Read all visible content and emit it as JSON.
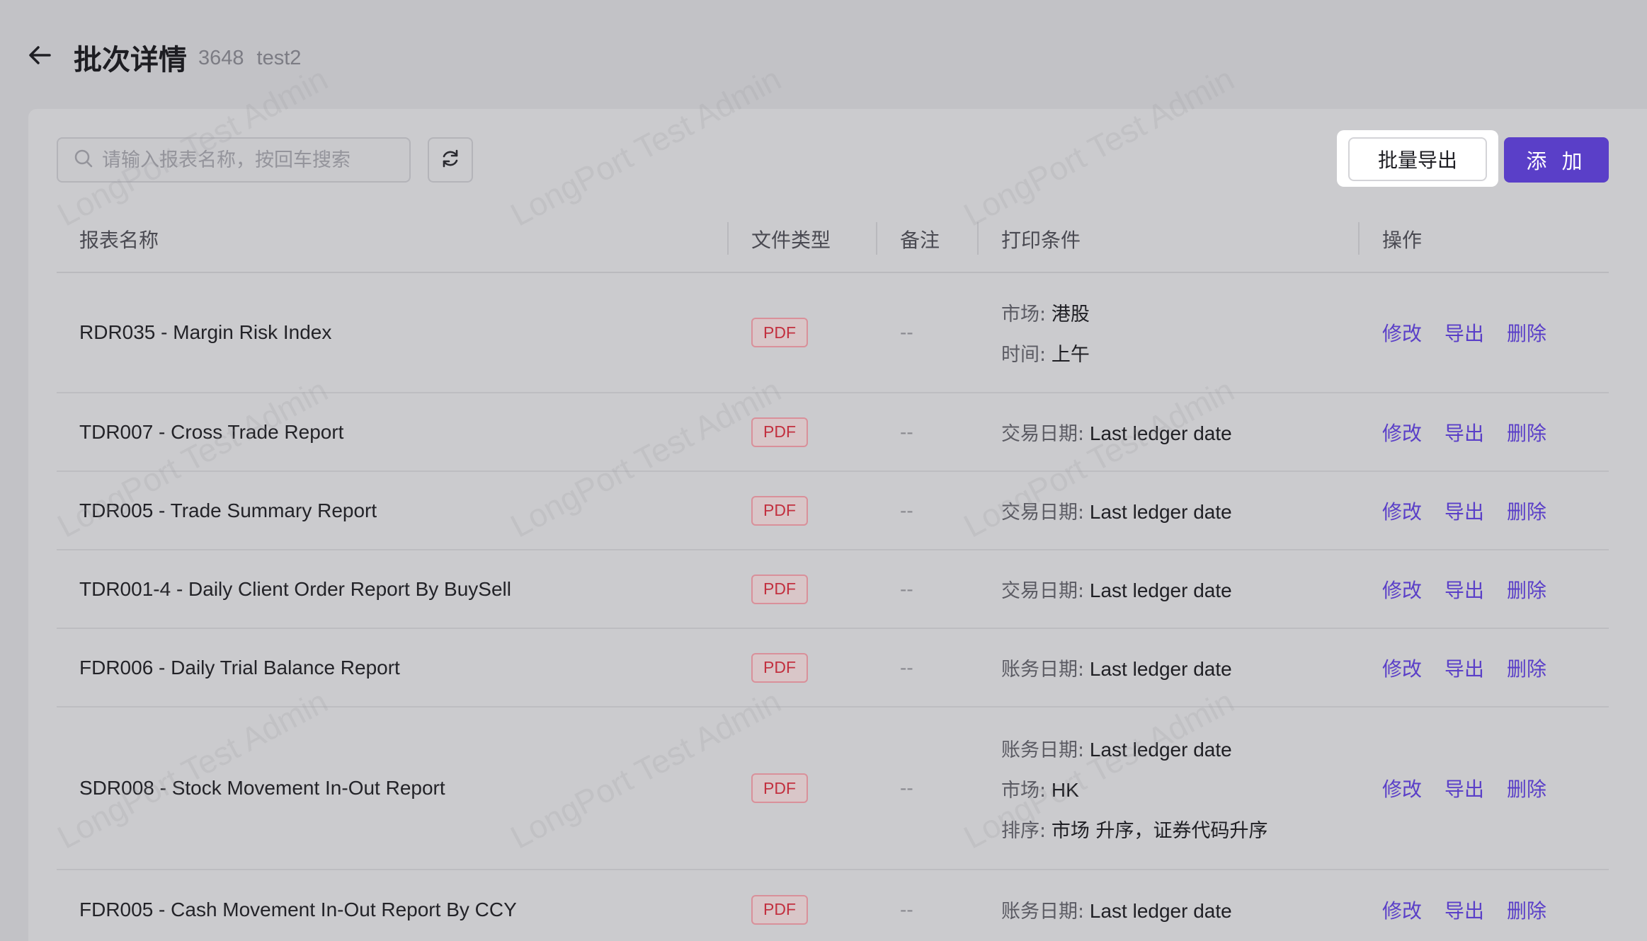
{
  "header": {
    "title": "批次详情",
    "batch_id": "3648",
    "batch_name": "test2"
  },
  "toolbar": {
    "search_placeholder": "请输入报表名称，按回车搜索",
    "batch_export_label": "批量导出",
    "add_label": "添 加"
  },
  "table": {
    "columns": [
      "报表名称",
      "文件类型",
      "备注",
      "打印条件",
      "操作"
    ],
    "rows": [
      {
        "name": "RDR035 - Margin Risk Index",
        "type": "PDF",
        "note": "--",
        "conditions": [
          {
            "key": "市场:",
            "value": "港股"
          },
          {
            "key": "时间:",
            "value": "上午"
          }
        ]
      },
      {
        "name": "TDR007 - Cross Trade Report",
        "type": "PDF",
        "note": "--",
        "conditions": [
          {
            "key": "交易日期:",
            "value": "Last ledger date"
          }
        ]
      },
      {
        "name": "TDR005 - Trade Summary Report",
        "type": "PDF",
        "note": "--",
        "conditions": [
          {
            "key": "交易日期:",
            "value": "Last ledger date"
          }
        ]
      },
      {
        "name": "TDR001-4 - Daily Client Order Report By BuySell",
        "type": "PDF",
        "note": "--",
        "conditions": [
          {
            "key": "交易日期:",
            "value": "Last ledger date"
          }
        ]
      },
      {
        "name": "FDR006 - Daily Trial Balance Report",
        "type": "PDF",
        "note": "--",
        "conditions": [
          {
            "key": "账务日期:",
            "value": "Last ledger date"
          }
        ]
      },
      {
        "name": "SDR008 - Stock Movement In-Out Report",
        "type": "PDF",
        "note": "--",
        "conditions": [
          {
            "key": "账务日期:",
            "value": "Last ledger date"
          },
          {
            "key": "市场:",
            "value": "HK"
          },
          {
            "key": "排序:",
            "value": "市场 升序，证券代码升序"
          }
        ]
      },
      {
        "name": "FDR005 - Cash Movement In-Out Report By CCY",
        "type": "PDF",
        "note": "--",
        "conditions": [
          {
            "key": "账务日期:",
            "value": "Last ledger date"
          }
        ]
      }
    ],
    "actions": {
      "edit": "修改",
      "export": "导出",
      "delete": "删除"
    }
  },
  "watermark_text": "LongPort Test Admin",
  "colors": {
    "primary": "#5a3fc8",
    "pdf_tag": "#c2303f",
    "background": "#c2c2c6"
  }
}
